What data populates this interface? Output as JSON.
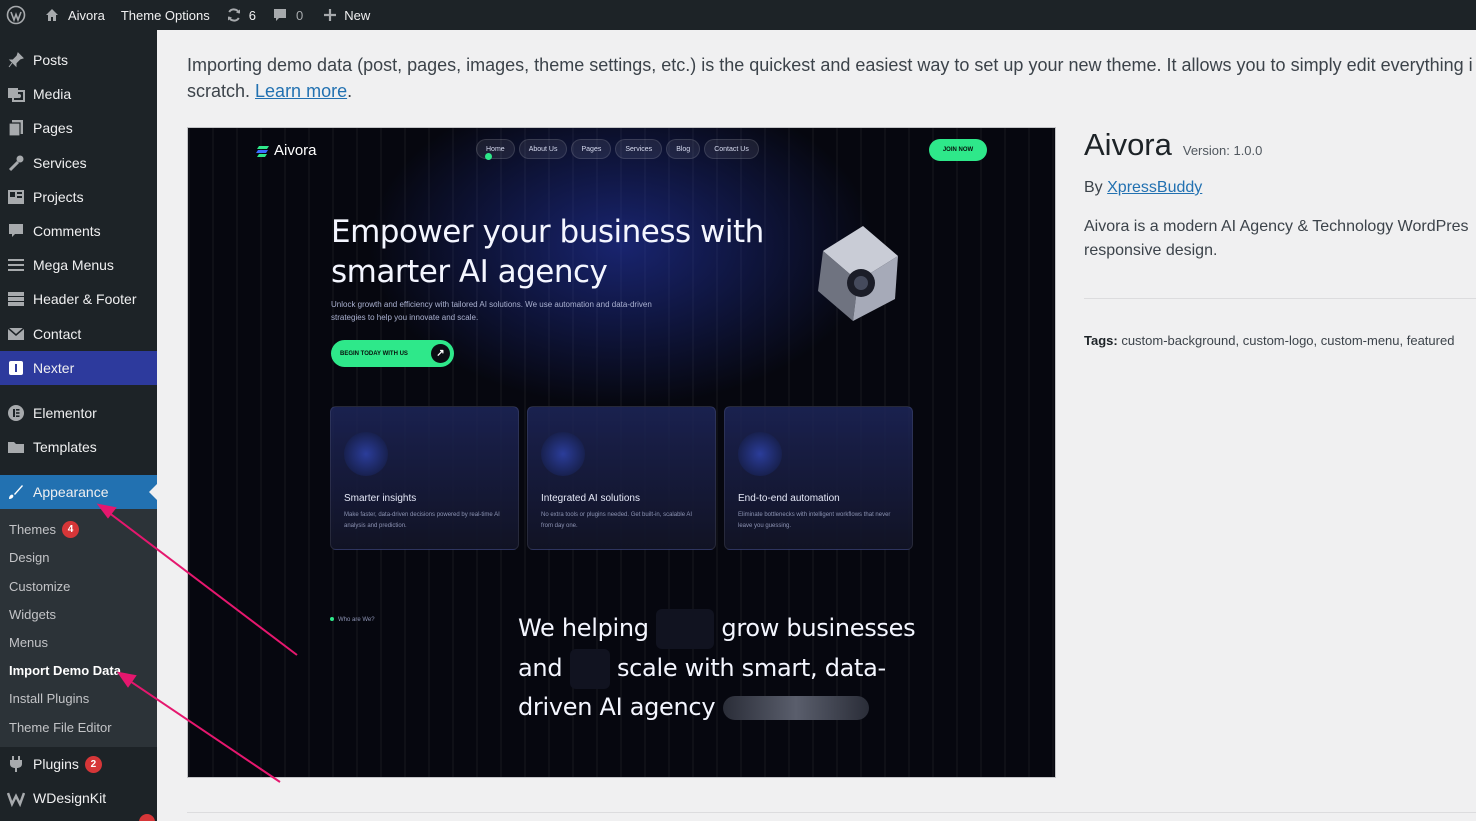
{
  "admin_bar": {
    "site_name": "Aivora",
    "theme_options": "Theme Options",
    "updates_count": "6",
    "comments_count": "0",
    "new_label": "New"
  },
  "sidebar": {
    "items": [
      {
        "label": "Posts",
        "icon": "pin-icon"
      },
      {
        "label": "Media",
        "icon": "media-icon"
      },
      {
        "label": "Pages",
        "icon": "pages-icon"
      },
      {
        "label": "Services",
        "icon": "wrench-icon"
      },
      {
        "label": "Projects",
        "icon": "portfolio-icon"
      },
      {
        "label": "Comments",
        "icon": "comment-icon"
      },
      {
        "label": "Mega Menus",
        "icon": "menu-icon"
      },
      {
        "label": "Header & Footer",
        "icon": "layout-icon"
      },
      {
        "label": "Contact",
        "icon": "mail-icon"
      },
      {
        "label": "Nexter",
        "icon": "nexter-icon"
      },
      {
        "label": "Elementor",
        "icon": "elementor-icon"
      },
      {
        "label": "Templates",
        "icon": "folder-icon"
      },
      {
        "label": "Appearance",
        "icon": "brush-icon"
      },
      {
        "label": "Plugins",
        "icon": "plugin-icon",
        "badge": "2"
      },
      {
        "label": "WDesignKit",
        "icon": "wdesignkit-icon"
      }
    ],
    "submenu": [
      {
        "label": "Themes",
        "badge": "4"
      },
      {
        "label": "Design"
      },
      {
        "label": "Customize"
      },
      {
        "label": "Widgets"
      },
      {
        "label": "Menus"
      },
      {
        "label": "Import Demo Data"
      },
      {
        "label": "Install Plugins"
      },
      {
        "label": "Theme File Editor"
      }
    ]
  },
  "main": {
    "intro_text": "Importing demo data (post, pages, images, theme settings, etc.) is the quickest and easiest way to set up your new theme. It allows you to simply edit everything i",
    "intro_text_2": "scratch. ",
    "learn_more": "Learn more",
    "period": "."
  },
  "preview": {
    "logo": "Aivora",
    "nav": [
      "Home",
      "About Us",
      "Pages",
      "Services",
      "Blog",
      "Contact Us"
    ],
    "join": "JOIN NOW",
    "headline": "Empower your business with smarter AI agency",
    "subtext": "Unlock growth and efficiency with tailored AI solutions. We use automation and data-driven strategies to help you innovate and scale.",
    "cta": "BEGIN TODAY WITH US",
    "cards": [
      {
        "title": "Smarter insights",
        "desc": "Make faster, data-driven decisions powered by real-time AI analysis and prediction."
      },
      {
        "title": "Integrated AI solutions",
        "desc": "No extra tools or plugins needed. Get built-in, scalable AI from day one."
      },
      {
        "title": "End-to-end automation",
        "desc": "Eliminate bottlenecks with intelligent workflows that never leave you guessing."
      }
    ],
    "who": "Who are We?",
    "h2_a": "We helping",
    "h2_b": "grow businesses",
    "h2_c": "and",
    "h2_d": "scale with smart, data-",
    "h2_e": "driven AI agency"
  },
  "theme": {
    "name": "Aivora",
    "version": "Version: 1.0.0",
    "by": "By ",
    "author": "XpressBuddy",
    "description_1": "Aivora is a modern AI Agency & Technology WordPres",
    "description_2": "responsive design.",
    "tags_label": "Tags:",
    "tags": " custom-background, custom-logo, custom-menu, featured"
  },
  "colors": {
    "admin_dark": "#1d2327",
    "accent_blue": "#2271b1",
    "nexter_blue": "#2d3a9d",
    "badge_red": "#d63638",
    "annotation_arrow": "#e5176e",
    "preview_green": "#2ee88a"
  }
}
